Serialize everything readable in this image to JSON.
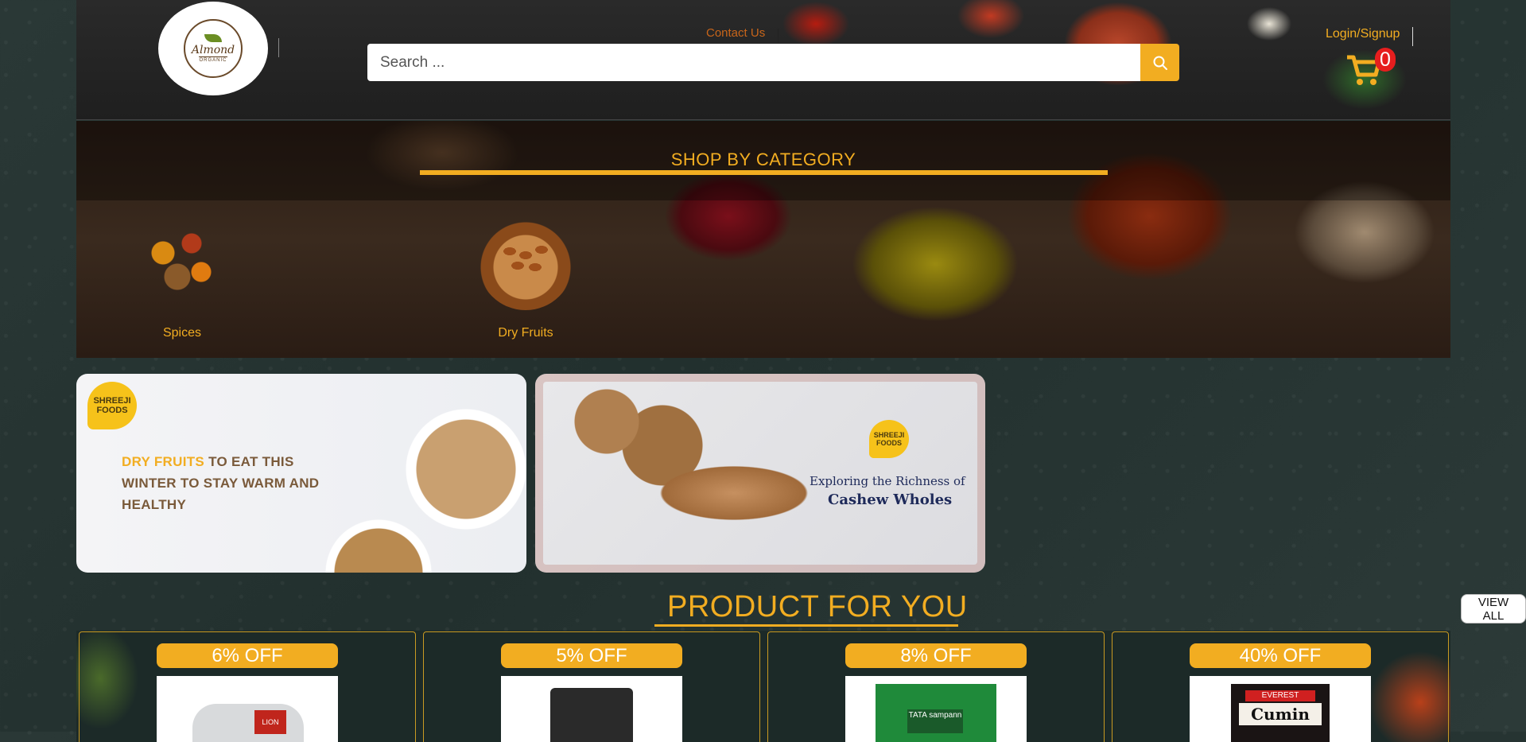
{
  "header": {
    "logo": {
      "name": "Almond",
      "tagline": "ORGANIC"
    },
    "contact_label": "Contact Us",
    "search": {
      "placeholder": "Search ..."
    },
    "login_label": "Login/Signup",
    "cart_count": "0"
  },
  "category": {
    "title": "SHOP BY CATEGORY",
    "items": [
      {
        "label": "Spices",
        "icon": "spices-image"
      },
      {
        "label": "Dry Fruits",
        "icon": "dry-fruits-image"
      }
    ]
  },
  "banners": [
    {
      "badge": "SHREEJI FOODS",
      "accent": "DRY FRUITS",
      "text": " TO EAT THIS WINTER TO STAY WARM AND HEALTHY"
    },
    {
      "badge": "SHREEJI FOODS",
      "line1": "Exploring the Richness of",
      "line2": "Cashew Wholes"
    }
  ],
  "products": {
    "title": "PRODUCT FOR YOU",
    "view_all_label": "VIEW ALL",
    "items": [
      {
        "discount": "6% OFF",
        "label": "LION"
      },
      {
        "discount": "5% OFF",
        "label": ""
      },
      {
        "discount": "8% OFF",
        "label": "TATA sampann"
      },
      {
        "discount": "40% OFF",
        "brand": "EVEREST",
        "label": "Cumin"
      }
    ]
  },
  "colors": {
    "accent": "#f2ad21",
    "cart_badge": "#e61e1e",
    "contact_link": "#c8651a"
  }
}
